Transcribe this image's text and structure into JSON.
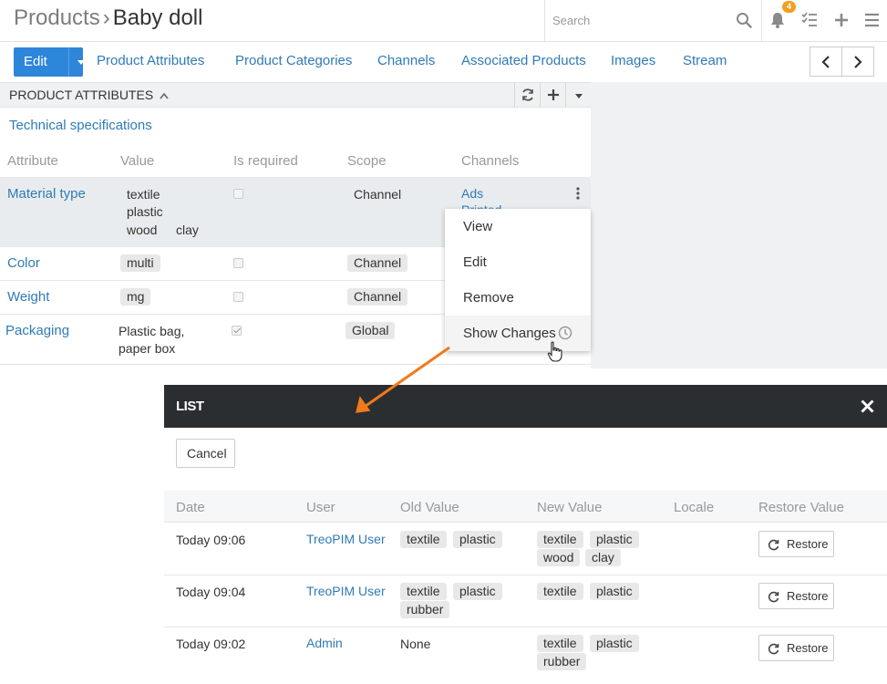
{
  "header": {
    "breadcrumb_parent": "Products",
    "breadcrumb_sep": "›",
    "breadcrumb_current": "Baby doll",
    "search_placeholder": "Search",
    "notification_count": "4"
  },
  "toolbar": {
    "edit_label": "Edit",
    "tabs": [
      "Product Attributes",
      "Product Categories",
      "Channels",
      "Associated Products",
      "Images",
      "Stream"
    ]
  },
  "panel": {
    "title": "PRODUCT ATTRIBUTES",
    "section": "Technical specifications",
    "columns": [
      "Attribute",
      "Value",
      "Is required",
      "Scope",
      "Channels"
    ],
    "rows": [
      {
        "attribute": "Material type",
        "values": [
          "textile",
          "plastic",
          "wood",
          "clay"
        ],
        "required": false,
        "scope": "Channel",
        "channels": [
          "Ads",
          "Printed"
        ]
      },
      {
        "attribute": "Color",
        "values": [
          "multi"
        ],
        "required": false,
        "scope": "Channel"
      },
      {
        "attribute": "Weight",
        "values": [
          "mg"
        ],
        "required": false,
        "scope": "Channel"
      },
      {
        "attribute": "Packaging",
        "value_line1": "Plastic bag,",
        "value_line2": "paper box",
        "required": true,
        "scope": "Global"
      }
    ]
  },
  "context_menu": {
    "items": [
      "View",
      "Edit",
      "Remove",
      "Show Changes"
    ]
  },
  "modal": {
    "title": "LIST",
    "cancel_label": "Cancel",
    "columns": [
      "Date",
      "User",
      "Old Value",
      "New Value",
      "Locale",
      "Restore Value"
    ],
    "restore_label": "Restore",
    "rows": [
      {
        "date": "Today 09:06",
        "user": "TreoPIM User",
        "old": [
          "textile",
          "plastic"
        ],
        "new": [
          "textile",
          "plastic",
          "wood",
          "clay"
        ]
      },
      {
        "date": "Today 09:04",
        "user": "TreoPIM User",
        "old": [
          "textile",
          "plastic",
          "rubber"
        ],
        "new": [
          "textile",
          "plastic"
        ]
      },
      {
        "date": "Today 09:02",
        "user": "Admin",
        "old_text": "None",
        "new": [
          "textile",
          "plastic",
          "rubber"
        ]
      }
    ]
  },
  "colors": {
    "primary": "#2d86d9",
    "link": "#2f7bb6",
    "modal_header": "#2b2e31",
    "arrow": "#f07a1a",
    "badge": "#f0a020"
  }
}
